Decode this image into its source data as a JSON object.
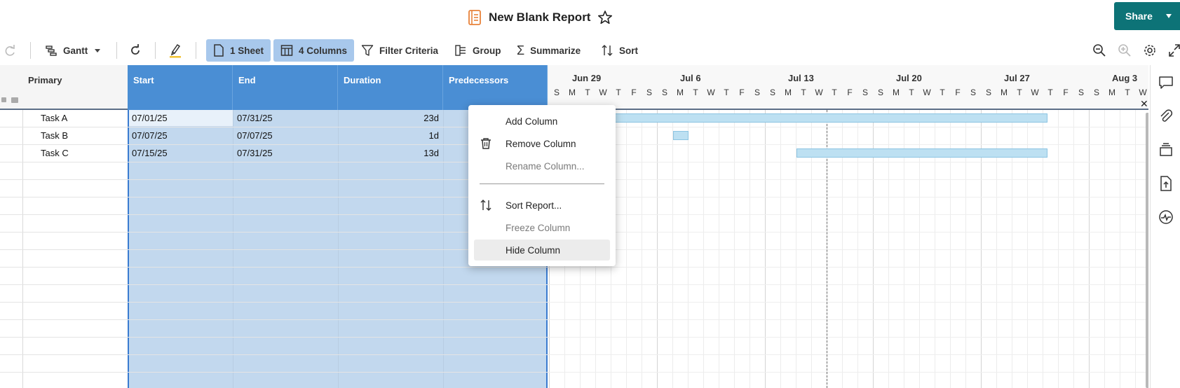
{
  "header": {
    "title": "New Blank Report",
    "share_label": "Share"
  },
  "toolbar": {
    "view_label": "Gantt",
    "sheets_label": "1 Sheet",
    "columns_label": "4 Columns",
    "filter_label": "Filter Criteria",
    "group_label": "Group",
    "summarize_label": "Summarize",
    "sort_label": "Sort"
  },
  "grid": {
    "columns": [
      "Primary",
      "Start",
      "End",
      "Duration",
      "Predecessors"
    ],
    "rows": [
      {
        "primary": "Task A",
        "start": "07/01/25",
        "end": "07/31/25",
        "duration": "23d"
      },
      {
        "primary": "Task B",
        "start": "07/07/25",
        "end": "07/07/25",
        "duration": "1d"
      },
      {
        "primary": "Task C",
        "start": "07/15/25",
        "end": "07/31/25",
        "duration": "13d"
      }
    ]
  },
  "gantt": {
    "weeks": [
      "Jun 29",
      "Jul 6",
      "Jul 13",
      "Jul 20",
      "Jul 27",
      "Aug 3"
    ],
    "day_letters": [
      "S",
      "M",
      "T",
      "W",
      "T",
      "F",
      "S"
    ],
    "close_label": "✕"
  },
  "context_menu": {
    "items": [
      {
        "label": "Add Column",
        "enabled": true,
        "icon": ""
      },
      {
        "label": "Remove Column",
        "enabled": true,
        "icon": "trash-icon"
      },
      {
        "label": "Rename Column...",
        "enabled": false,
        "icon": ""
      },
      {
        "label": "Sort Report...",
        "enabled": true,
        "icon": "sort-icon"
      },
      {
        "label": "Freeze Column",
        "enabled": false,
        "icon": ""
      },
      {
        "label": "Hide Column",
        "enabled": true,
        "icon": ""
      }
    ]
  },
  "colors": {
    "accent": "#0d7377",
    "selection": "#c2d8ee",
    "header_selected": "#4a8ed4",
    "bar": "#bde0f2"
  }
}
